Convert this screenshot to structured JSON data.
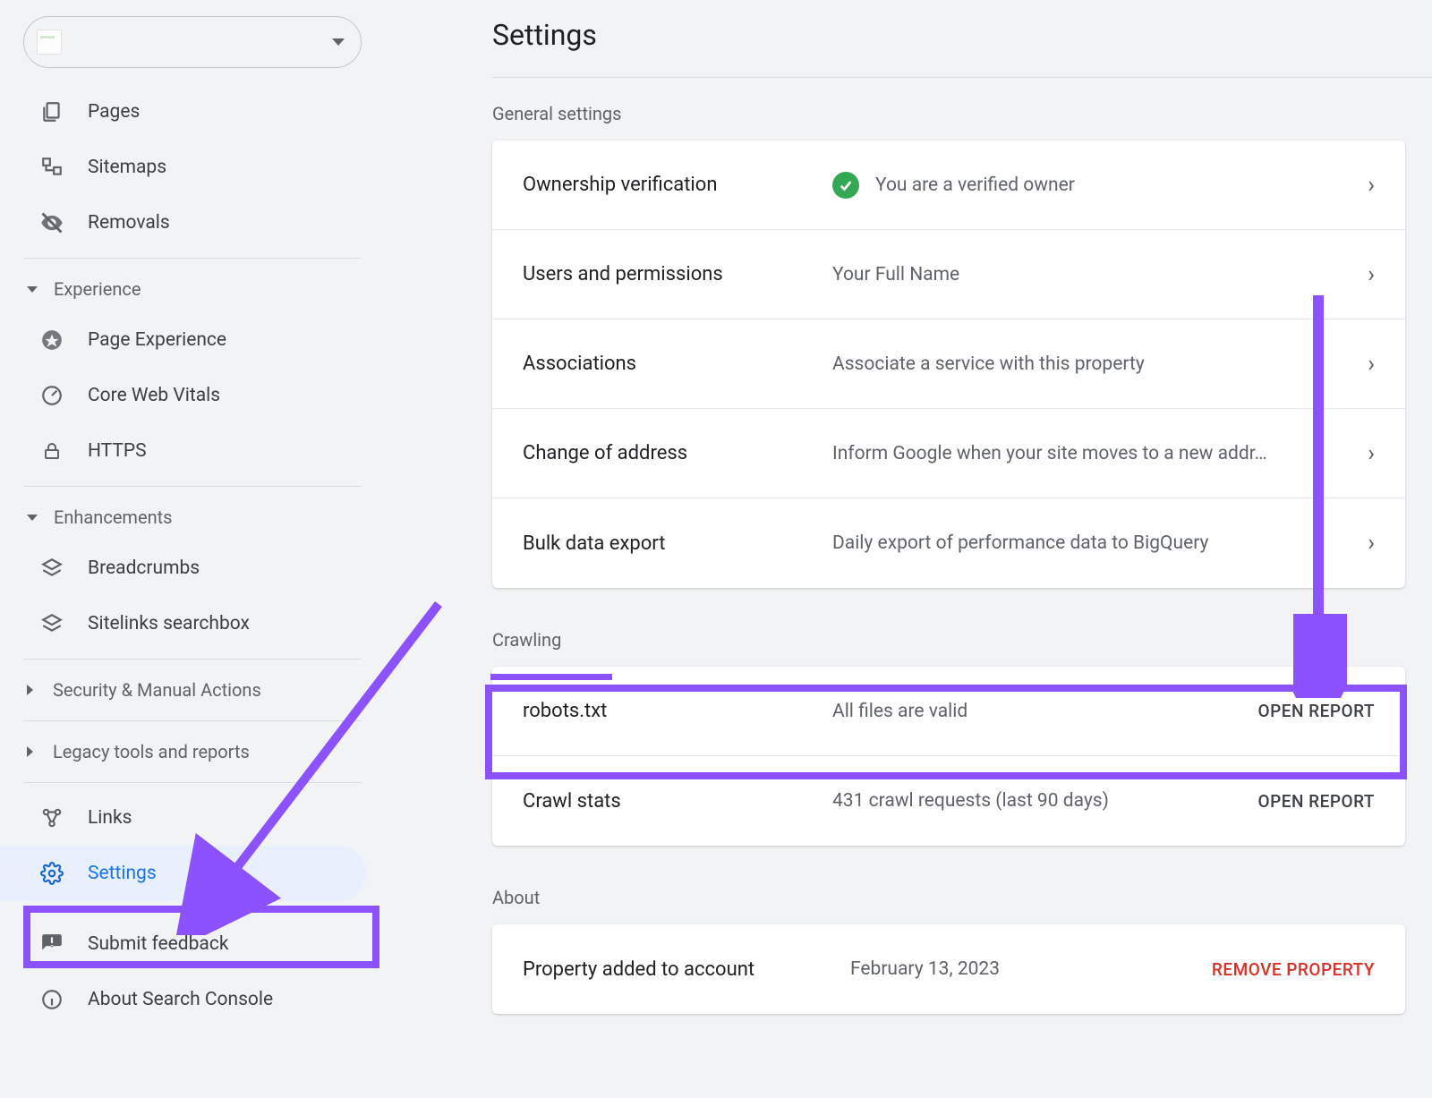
{
  "property_selector": {
    "label": ""
  },
  "sidebar": {
    "items_top": [
      {
        "id": "pages",
        "label": "Pages",
        "icon": "pages-icon"
      },
      {
        "id": "sitemaps",
        "label": "Sitemaps",
        "icon": "sitemaps-icon"
      },
      {
        "id": "removals",
        "label": "Removals",
        "icon": "removals-icon"
      }
    ],
    "groups": [
      {
        "heading": "Experience",
        "expanded": true,
        "items": [
          {
            "id": "page-experience",
            "label": "Page Experience",
            "icon": "page-experience-icon"
          },
          {
            "id": "cwv",
            "label": "Core Web Vitals",
            "icon": "cwv-icon"
          },
          {
            "id": "https",
            "label": "HTTPS",
            "icon": "https-icon"
          }
        ]
      },
      {
        "heading": "Enhancements",
        "expanded": true,
        "items": [
          {
            "id": "breadcrumbs",
            "label": "Breadcrumbs",
            "icon": "layers-icon"
          },
          {
            "id": "sitelinks",
            "label": "Sitelinks searchbox",
            "icon": "layers-icon"
          }
        ]
      },
      {
        "heading": "Security & Manual Actions",
        "expanded": false,
        "items": []
      },
      {
        "heading": "Legacy tools and reports",
        "expanded": false,
        "items": []
      }
    ],
    "bottom": [
      {
        "id": "links",
        "label": "Links",
        "icon": "links-icon"
      },
      {
        "id": "settings",
        "label": "Settings",
        "icon": "settings-icon",
        "active": true
      }
    ],
    "footer": [
      {
        "id": "feedback",
        "label": "Submit feedback",
        "icon": "feedback-icon"
      },
      {
        "id": "about",
        "label": "About Search Console",
        "icon": "info-icon"
      }
    ]
  },
  "main": {
    "title": "Settings",
    "sections": [
      {
        "label": "General settings",
        "rows": [
          {
            "label": "Ownership verification",
            "value": "You are a verified owner",
            "verified": true,
            "chevron": true
          },
          {
            "label": "Users and permissions",
            "value": "Your Full Name",
            "chevron": true
          },
          {
            "label": "Associations",
            "value": "Associate a service with this property",
            "chevron": true
          },
          {
            "label": "Change of address",
            "value": "Inform Google when your site moves to a new addr…",
            "chevron": true
          },
          {
            "label": "Bulk data export",
            "value": "Daily export of performance data to BigQuery",
            "chevron": true
          }
        ]
      },
      {
        "label": "Crawling",
        "rows": [
          {
            "label": "robots.txt",
            "value": "All files are valid",
            "action": "Open report"
          },
          {
            "label": "Crawl stats",
            "value": "431 crawl requests (last 90 days)",
            "action": "Open report"
          }
        ]
      },
      {
        "label": "About",
        "rows": [
          {
            "label": "Property added to account",
            "value": "February 13, 2023",
            "action": "Remove property",
            "danger": true
          }
        ]
      }
    ]
  }
}
